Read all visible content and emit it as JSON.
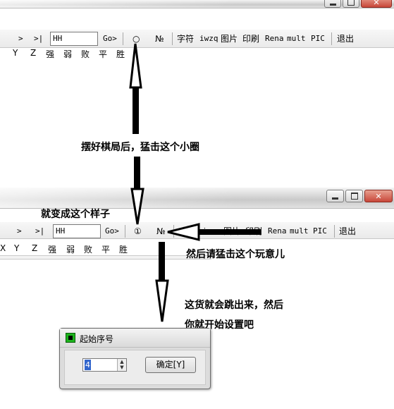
{
  "toolbar": {
    "next": ">",
    "last": ">|",
    "move_value": "HH",
    "go": "Go>",
    "circle_before": "○",
    "circle_after": "①",
    "numero": "№",
    "zifu": "字符",
    "iwzq": "iwzq",
    "tupian": "图片",
    "yinshua": "印刷",
    "rena": "Rena",
    "mult": "mult",
    "pic": "PIC",
    "exit": "退出"
  },
  "labels_row": [
    "Y",
    "Z",
    "强",
    "弱",
    "败",
    "平",
    "胜"
  ],
  "labels_row2": [
    "X",
    "Y",
    "Z",
    "强",
    "弱",
    "败",
    "平",
    "胜"
  ],
  "captions": {
    "step1": "摆好棋局后，猛击这个小圈",
    "step2": "就变成这个样子",
    "step3": "然后请猛击这个玩意儿",
    "step4_line1": "这货就会跳出来，然后",
    "step4_line2": "你就开始设置吧"
  },
  "dialog": {
    "title": "起始序号",
    "spin_value": "4",
    "ok_label": "确定[Y]"
  },
  "colors": {
    "arrow": "#000000",
    "close_button": "#c8473a",
    "selection": "#3366cc"
  }
}
